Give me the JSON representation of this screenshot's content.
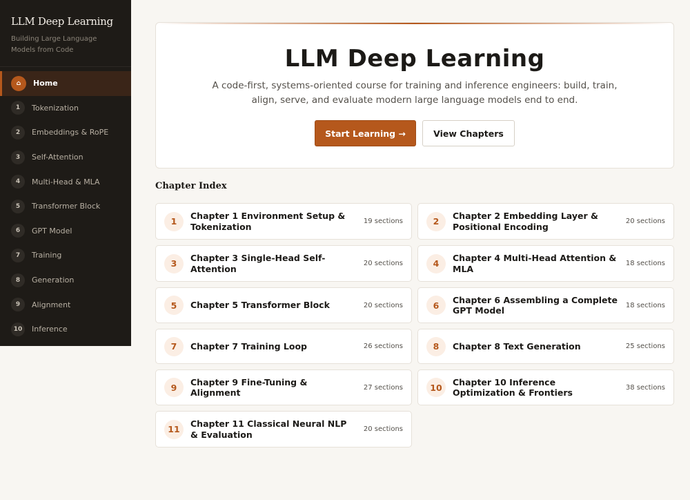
{
  "sidebar": {
    "title": "LLM Deep Learning",
    "subtitle": "Building Large Language Models from Code",
    "items": [
      {
        "num": "⌂",
        "label": "Home",
        "icon": "home-icon"
      },
      {
        "num": "1",
        "label": "Tokenization"
      },
      {
        "num": "2",
        "label": "Embeddings & RoPE"
      },
      {
        "num": "3",
        "label": "Self-Attention"
      },
      {
        "num": "4",
        "label": "Multi-Head & MLA"
      },
      {
        "num": "5",
        "label": "Transformer Block"
      },
      {
        "num": "6",
        "label": "GPT Model"
      },
      {
        "num": "7",
        "label": "Training"
      },
      {
        "num": "8",
        "label": "Generation"
      },
      {
        "num": "9",
        "label": "Alignment"
      },
      {
        "num": "10",
        "label": "Inference"
      }
    ]
  },
  "hero": {
    "title": "LLM Deep Learning",
    "description": "A code-first, systems-oriented course for training and inference engineers: build, train, align, serve, and evaluate modern large language models end to end.",
    "primary_button": "Start Learning →",
    "secondary_button": "View Chapters"
  },
  "chapter_index": {
    "title": "Chapter Index",
    "chapters": [
      {
        "num": "1",
        "title": "Chapter 1 Environment Setup & Tokenization",
        "count": "19 sections"
      },
      {
        "num": "2",
        "title": "Chapter 2 Embedding Layer & Positional Encoding",
        "count": "20 sections"
      },
      {
        "num": "3",
        "title": "Chapter 3 Single-Head Self-Attention",
        "count": "20 sections"
      },
      {
        "num": "4",
        "title": "Chapter 4 Multi-Head Attention & MLA",
        "count": "18 sections"
      },
      {
        "num": "5",
        "title": "Chapter 5 Transformer Block",
        "count": "20 sections"
      },
      {
        "num": "6",
        "title": "Chapter 6 Assembling a Complete GPT Model",
        "count": "18 sections"
      },
      {
        "num": "7",
        "title": "Chapter 7 Training Loop",
        "count": "26 sections"
      },
      {
        "num": "8",
        "title": "Chapter 8 Text Generation",
        "count": "25 sections"
      },
      {
        "num": "9",
        "title": "Chapter 9 Fine-Tuning & Alignment",
        "count": "27 sections"
      },
      {
        "num": "10",
        "title": "Chapter 10 Inference Optimization & Frontiers",
        "count": "38 sections"
      },
      {
        "num": "11",
        "title": "Chapter 11 Classical Neural NLP & Evaluation",
        "count": "20 sections"
      }
    ]
  },
  "colors": {
    "accent": "#b5581c",
    "sidebar_bg": "#1e1b17",
    "page_bg": "#f8f6f2"
  }
}
